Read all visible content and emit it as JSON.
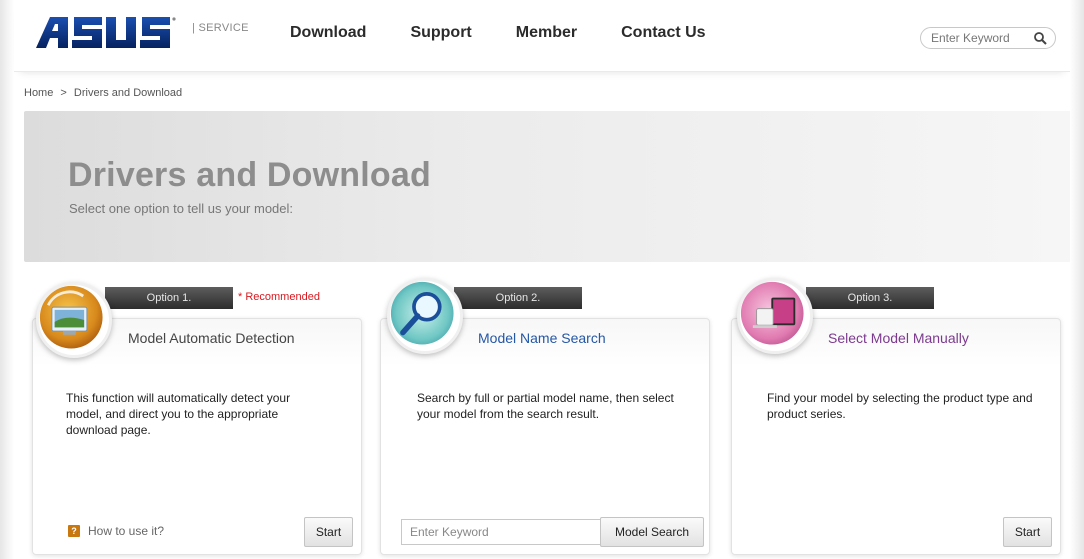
{
  "header": {
    "logo_alt": "ASUS",
    "service_label": "| SERVICE",
    "nav": [
      "Download",
      "Support",
      "Member",
      "Contact Us"
    ],
    "search_placeholder": "Enter Keyword"
  },
  "breadcrumb": [
    "Home",
    ">",
    "Drivers and Download"
  ],
  "hero": {
    "title": "Drivers and Download",
    "subtitle": "Select one option to tell us your model:"
  },
  "options": [
    {
      "tab": "Option 1.",
      "badge": "* Recommended",
      "title": "Model Automatic Detection",
      "description": "This function will automatically detect your model, and direct you to the appropriate download page.",
      "help_label": "How to use it?",
      "help_icon": "question-icon",
      "button": "Start",
      "icon": "monitor-detect-icon"
    },
    {
      "tab": "Option 2.",
      "title": "Model Name Search",
      "description": "Search by full or partial model name, then select your model from the search result.",
      "input_placeholder": "Enter Keyword",
      "button": "Model Search",
      "icon": "magnifier-icon"
    },
    {
      "tab": "Option 3.",
      "title": "Select Model Manually",
      "description": "Find your model by selecting the product type and product series.",
      "button": "Start",
      "icon": "devices-icon"
    }
  ],
  "colors": {
    "recommended": "#d71920",
    "option2_title": "#2457a6",
    "option3_title": "#7c3a8e",
    "logo_blue": "#0b3a8c"
  }
}
